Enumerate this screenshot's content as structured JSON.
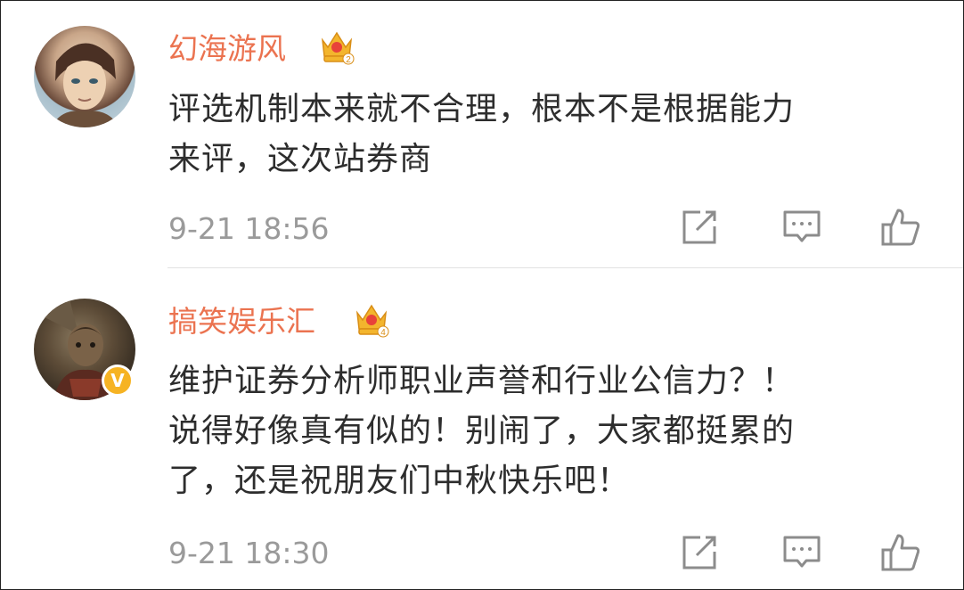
{
  "comments": [
    {
      "username": "幻海游风",
      "vip_level": "2",
      "verified": false,
      "lines": [
        "评选机制本来就不合理，根本不是根据能力",
        "来评，这次站券商"
      ],
      "time": "9-21 18:56",
      "actions": [
        "repost-icon",
        "comment-icon",
        "like-icon"
      ]
    },
    {
      "username": "搞笑娱乐汇",
      "vip_level": "4",
      "verified": true,
      "verified_mark": "V",
      "lines": [
        "维护证券分析师职业声誉和行业公信力？！",
        "说得好像真有似的！别闹了，大家都挺累的",
        "了，还是祝朋友们中秋快乐吧！"
      ],
      "time": "9-21 18:30",
      "actions": [
        "repost-icon",
        "comment-icon",
        "like-icon"
      ]
    }
  ],
  "colors": {
    "username": "#eb7350",
    "text": "#2d2d2d",
    "timestamp": "#9a9a9a",
    "icon": "#8c8c8c",
    "crown": "#f3b52d",
    "verified_badge": "#f6b323"
  }
}
